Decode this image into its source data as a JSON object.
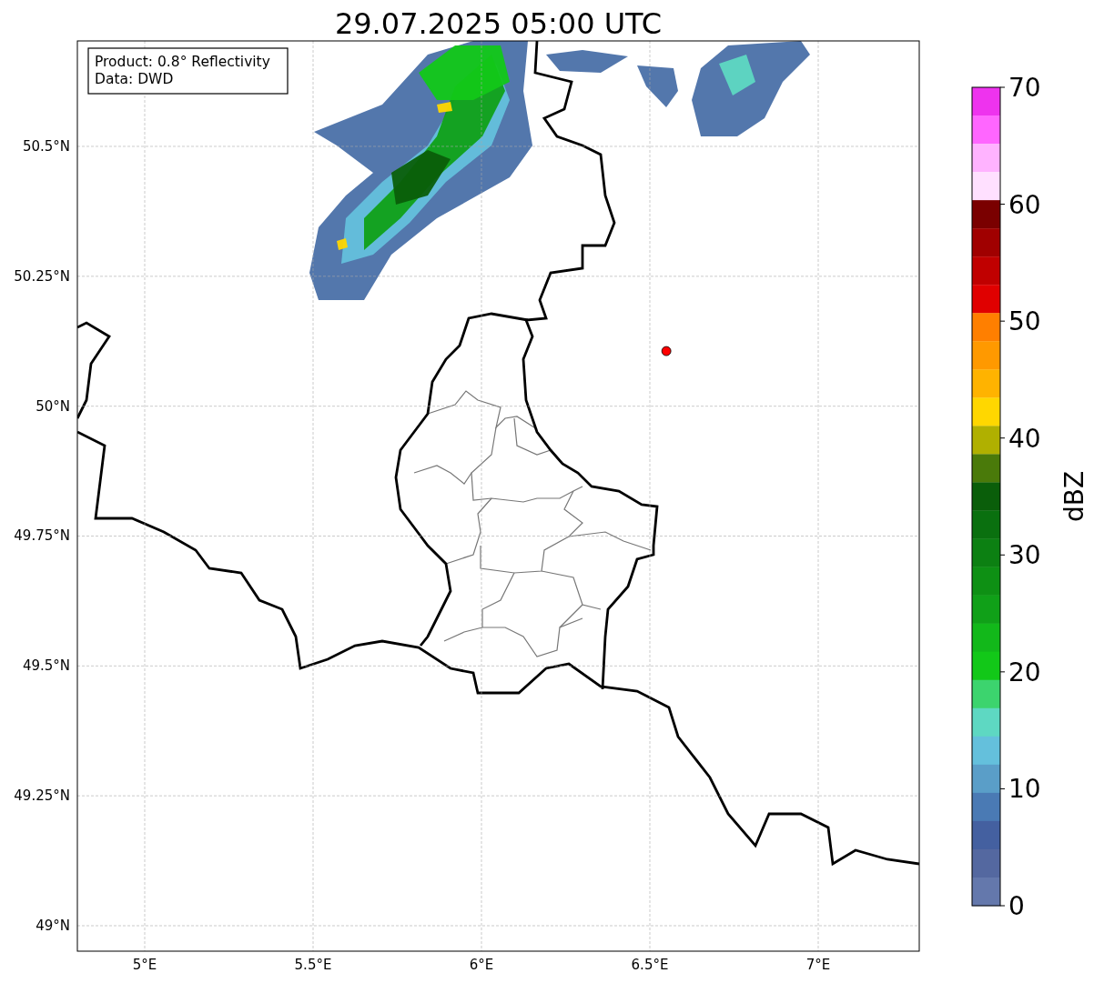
{
  "title": "29.07.2025 05:00 UTC",
  "info_box": [
    "Product: 0.8° Reflectivity",
    "Data: DWD"
  ],
  "map": {
    "xticks": [
      "5°E",
      "5.5°E",
      "6°E",
      "6.5°E",
      "7°E"
    ],
    "yticks": [
      "50.5°N",
      "50.25°N",
      "50°N",
      "49.75°N",
      "49.5°N",
      "49.25°N",
      "49°N"
    ],
    "marker": {
      "color": "#ff0000"
    }
  },
  "colorbar": {
    "label": "dBZ",
    "ticks": [
      "70",
      "60",
      "50",
      "40",
      "30",
      "20",
      "10",
      "0"
    ],
    "segments": [
      {
        "color": "#ee33ee"
      },
      {
        "color": "#ff66ff"
      },
      {
        "color": "#ffb3ff"
      },
      {
        "color": "#ffe0ff"
      },
      {
        "color": "#7a0000"
      },
      {
        "color": "#a00000"
      },
      {
        "color": "#c00000"
      },
      {
        "color": "#e00000"
      },
      {
        "color": "#ff7f00"
      },
      {
        "color": "#ff9900"
      },
      {
        "color": "#ffb300"
      },
      {
        "color": "#ffd700"
      },
      {
        "color": "#b0b000"
      },
      {
        "color": "#4a7a0a"
      },
      {
        "color": "#0a5e0a"
      },
      {
        "color": "#0a700f"
      },
      {
        "color": "#0c8012"
      },
      {
        "color": "#0e9014"
      },
      {
        "color": "#10a018"
      },
      {
        "color": "#12b81a"
      },
      {
        "color": "#12c818"
      },
      {
        "color": "#3cd46e"
      },
      {
        "color": "#5ed8c2"
      },
      {
        "color": "#64c0dc"
      },
      {
        "color": "#5a9ec8"
      },
      {
        "color": "#4a7ab4"
      },
      {
        "color": "#4460a0"
      },
      {
        "color": "#5468a0"
      },
      {
        "color": "#6478ac"
      }
    ]
  }
}
